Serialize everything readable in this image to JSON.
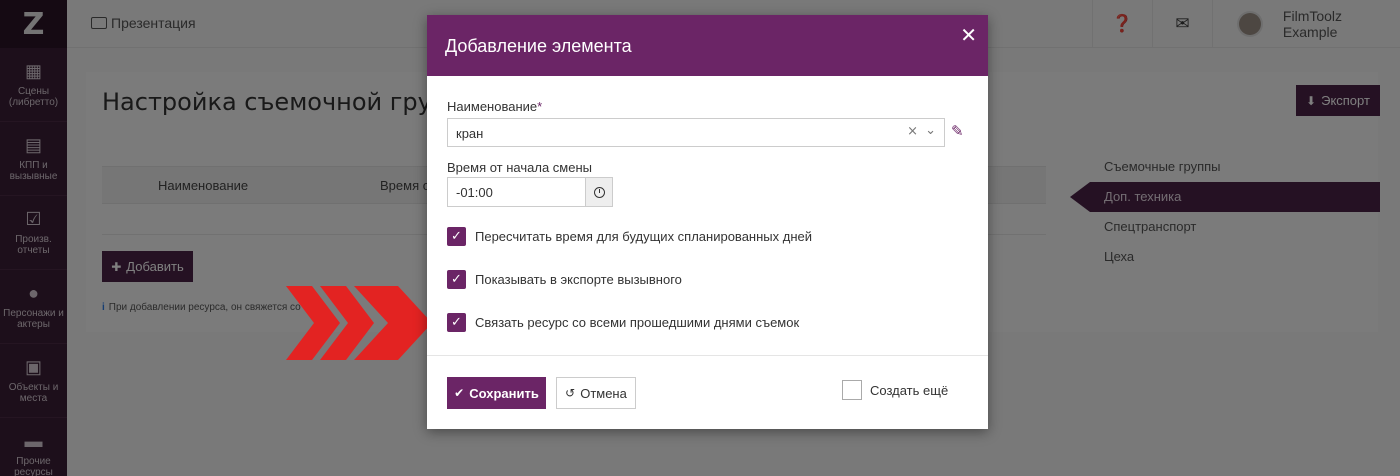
{
  "sidebar": {
    "logo": "Z",
    "items": [
      {
        "label": "Сцены (либретто)",
        "icon": "clapperboard-icon"
      },
      {
        "label": "КПП и вызывные",
        "icon": "calendar-icon"
      },
      {
        "label": "Произв. отчеты",
        "icon": "checkbox-icon"
      },
      {
        "label": "Персонажи и актеры",
        "icon": "users-icon"
      },
      {
        "label": "Объекты и места",
        "icon": "image-icon"
      },
      {
        "label": "Прочие ресурсы",
        "icon": "archive-icon"
      }
    ]
  },
  "topbar": {
    "breadcrumb": "Презентация",
    "user_name": "FilmToolz Example"
  },
  "page": {
    "title": "Настройка съемочной группы",
    "export_label": "Экспорт",
    "table_headers": [
      "Наименование",
      "Время от"
    ],
    "add_label": "Добавить",
    "hint": "При добавлении ресурса, он свяжется со ...",
    "right_nav": [
      {
        "label": "Съемочные группы",
        "active": false
      },
      {
        "label": "Доп. техника",
        "active": true
      },
      {
        "label": "Спецтранспорт",
        "active": false
      },
      {
        "label": "Цеха",
        "active": false
      }
    ]
  },
  "modal": {
    "title": "Добавление элемента",
    "name_label": "Наименование",
    "name_required": "*",
    "name_value": "кран",
    "time_label": "Время от начала смены",
    "time_value": "-01:00",
    "checkboxes": [
      {
        "label": "Пересчитать время для будущих спланированных дней",
        "checked": true
      },
      {
        "label": "Показывать в экспорте вызывного",
        "checked": true
      },
      {
        "label": "Связать ресурс со всеми прошедшими днями съемок",
        "checked": true
      }
    ],
    "save_label": "Сохранить",
    "cancel_label": "Отмена",
    "create_more_label": "Создать ещё",
    "create_more_checked": false
  },
  "colors": {
    "brand": "#6b2566",
    "sidebar": "#3a1f36",
    "arrow": "#e32322"
  }
}
